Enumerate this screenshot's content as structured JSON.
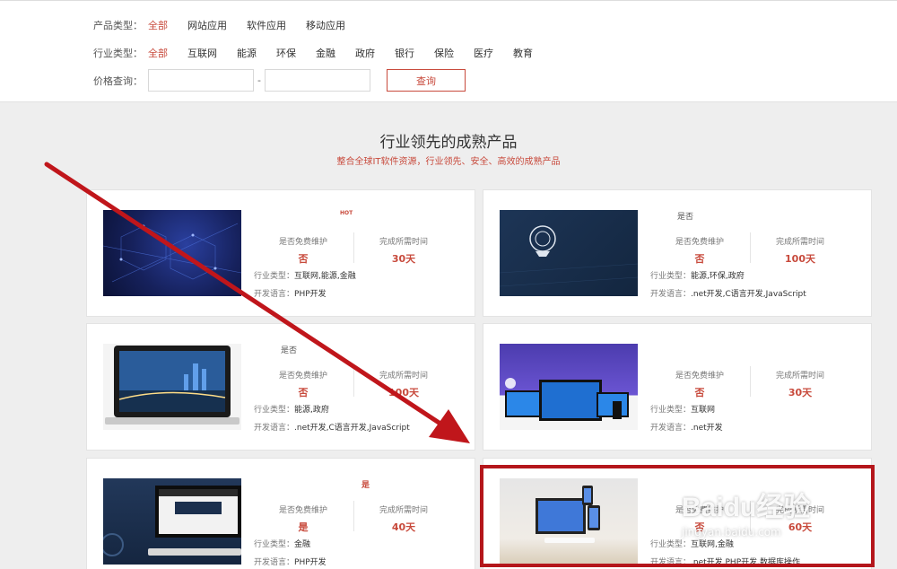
{
  "filters": {
    "product_type": {
      "label": "产品类型：",
      "options": [
        "全部",
        "网站应用",
        "软件应用",
        "移动应用"
      ],
      "active": 0
    },
    "industry_type": {
      "label": "行业类型：",
      "options": [
        "全部",
        "互联网",
        "能源",
        "环保",
        "金融",
        "政府",
        "银行",
        "保险",
        "医疗",
        "教育"
      ],
      "active": 0
    },
    "price": {
      "label": "价格查询：",
      "min_value": "",
      "max_value": "",
      "separator": "-",
      "button": "查询"
    }
  },
  "section": {
    "title": "行业领先的成熟产品",
    "subtitle": "整合全球IT软件资源，行业领先、安全、高效的成熟产品"
  },
  "card_labels": {
    "maintenance": "是否免费维护",
    "time": "完成所需时间",
    "industry": "行业类型：",
    "language": "开发语言："
  },
  "cards": [
    {
      "flag": "",
      "badge": "HOT",
      "maintenance": "否",
      "time": "30天",
      "industry": "互联网,能源,金融",
      "language": "PHP开发",
      "thumb": "dark-network"
    },
    {
      "flag": "是否",
      "badge": "",
      "maintenance": "否",
      "time": "100天",
      "industry": "能源,环保,政府",
      "language": ".net开发,C语言开发,JavaScript",
      "thumb": "police-emblem"
    },
    {
      "flag": "是否",
      "badge": "",
      "maintenance": "否",
      "time": "100天",
      "industry": "能源,政府",
      "language": ".net开发,C语言开发,JavaScript",
      "thumb": "laptop-city"
    },
    {
      "flag": "",
      "badge": "",
      "maintenance": "否",
      "time": "30天",
      "industry": "互联网",
      "language": ".net开发",
      "thumb": "multi-device"
    },
    {
      "flag": "是",
      "badge": "",
      "maintenance": "是",
      "time": "40天",
      "industry": "金融",
      "language": "PHP开发",
      "thumb": "monitor-dark"
    },
    {
      "flag": "",
      "badge": "",
      "maintenance": "否",
      "time": "60天",
      "industry": "互联网,金融",
      "language": ".net开发,PHP开发,数据库操作",
      "thumb": "desk-devices"
    }
  ],
  "annotation": {
    "arrow_color": "#c0161b",
    "box_color": "#b4161b"
  },
  "watermark": {
    "brand": "Baidu经验",
    "url": "jingyan.baidu.com"
  },
  "colors": {
    "accent": "#c84a3c",
    "background": "#eeeeee"
  }
}
